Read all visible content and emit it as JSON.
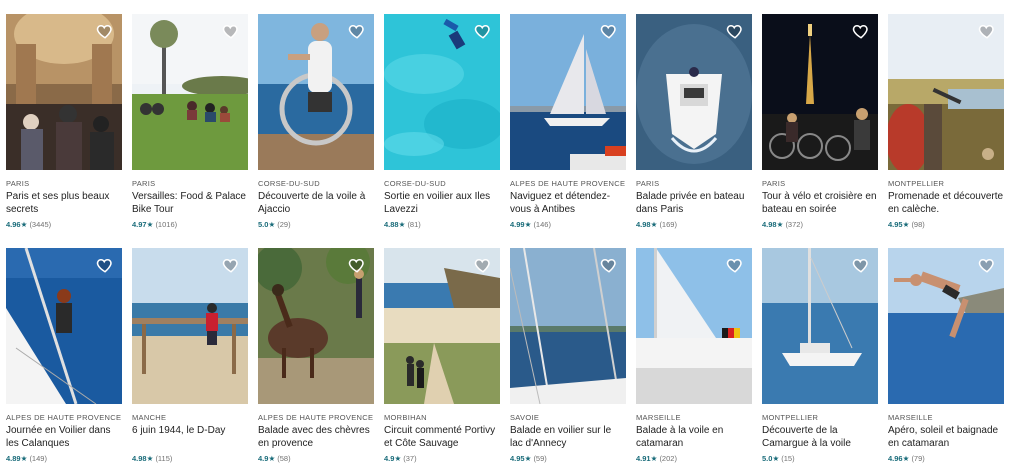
{
  "experiences": [
    {
      "location": "PARIS",
      "title": "Paris et ses plus beaux secrets",
      "rating": "4.96",
      "reviews": "(3445)"
    },
    {
      "location": "PARIS",
      "title": "Versailles: Food & Palace Bike Tour",
      "rating": "4.97",
      "reviews": "(1016)"
    },
    {
      "location": "CORSE-DU-SUD",
      "title": "Découverte de la voile à Ajaccio",
      "rating": "5.0",
      "reviews": "(29)"
    },
    {
      "location": "CORSE-DU-SUD",
      "title": "Sortie en voilier aux Iles Lavezzi",
      "rating": "4.88",
      "reviews": "(81)"
    },
    {
      "location": "ALPES DE HAUTE PROVENCE",
      "title": "Naviguez et détendez-vous à Antibes",
      "rating": "4.99",
      "reviews": "(146)"
    },
    {
      "location": "PARIS",
      "title": "Balade privée en bateau dans Paris",
      "rating": "4.98",
      "reviews": "(169)"
    },
    {
      "location": "PARIS",
      "title": "Tour à vélo et croisière en bateau en soirée",
      "rating": "4.98",
      "reviews": "(372)"
    },
    {
      "location": "MONTPELLIER",
      "title": "Promenade et découverte en calèche.",
      "rating": "4.95",
      "reviews": "(98)"
    },
    {
      "location": "ALPES DE HAUTE PROVENCE",
      "title": "Journée en Voilier dans les Calanques",
      "rating": "4.89",
      "reviews": "(149)"
    },
    {
      "location": "MANCHE",
      "title": "6 juin 1944, le D-Day",
      "rating": "4.98",
      "reviews": "(115)"
    },
    {
      "location": "ALPES DE HAUTE PROVENCE",
      "title": "Balade avec des chèvres en provence",
      "rating": "4.9",
      "reviews": "(58)"
    },
    {
      "location": "MORBIHAN",
      "title": "Circuit commenté Portivy et Côte Sauvage",
      "rating": "4.9",
      "reviews": "(37)"
    },
    {
      "location": "SAVOIE",
      "title": "Balade en voilier sur le lac d'Annecy",
      "rating": "4.95",
      "reviews": "(59)"
    },
    {
      "location": "MARSEILLE",
      "title": "Balade à la voile en catamaran",
      "rating": "4.91",
      "reviews": "(202)"
    },
    {
      "location": "MONTPELLIER",
      "title": "Découverte de la Camargue à la voile",
      "rating": "5.0",
      "reviews": "(15)"
    },
    {
      "location": "MARSEILLE",
      "title": "Apéro, soleil et baignade en catamaran",
      "rating": "4.96",
      "reviews": "(79)"
    }
  ],
  "star_glyph": "★",
  "icons": {
    "favorite": "heart-outline-icon"
  },
  "colors": {
    "rating": "#1a6c7a",
    "text": "#222222",
    "muted": "#717171"
  }
}
